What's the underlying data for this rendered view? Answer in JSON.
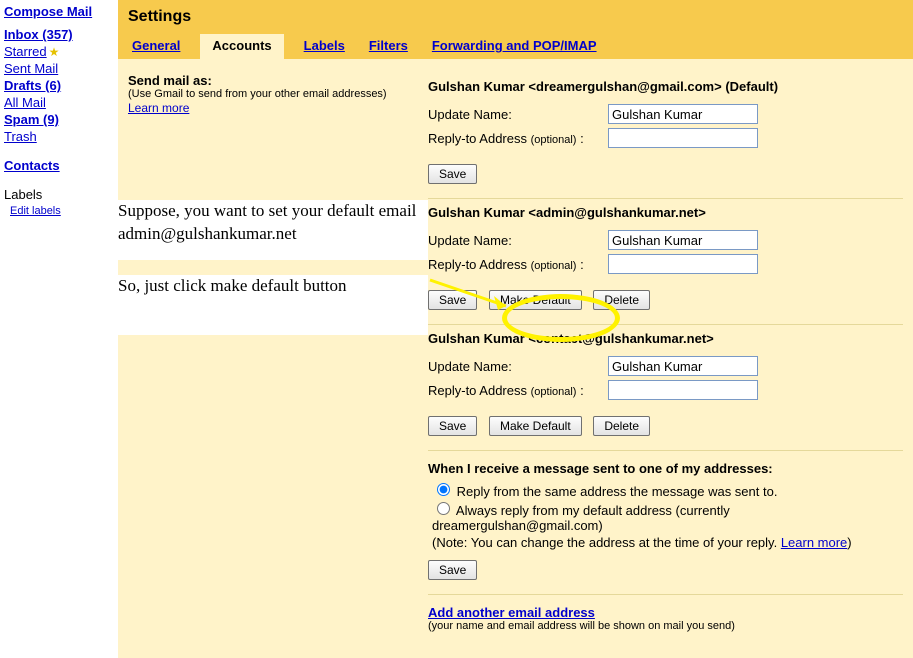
{
  "sidebar": {
    "compose": "Compose Mail",
    "items": [
      {
        "label": "Inbox (357)",
        "bold": true
      },
      {
        "label": "Starred",
        "star": true
      },
      {
        "label": "Sent Mail"
      },
      {
        "label": "Drafts (6)",
        "bold": true
      },
      {
        "label": "All Mail"
      },
      {
        "label": "Spam (9)",
        "bold": true
      },
      {
        "label": "Trash"
      }
    ],
    "contacts": "Contacts",
    "labels_head": "Labels",
    "edit_labels": "Edit labels"
  },
  "settings": {
    "title": "Settings",
    "tabs": [
      "General",
      "Accounts",
      "Labels",
      "Filters",
      "Forwarding and POP/IMAP"
    ],
    "active_tab": 1,
    "send_as": {
      "head": "Send mail as:",
      "sub": "(Use Gmail to send from your other email addresses)",
      "learn_more": "Learn more"
    },
    "labels": {
      "update_name": "Update Name:",
      "reply_to": "Reply-to Address ",
      "optional": "(optional)",
      "colon": ":",
      "save": "Save",
      "make_default": "Make Default",
      "delete": "Delete"
    },
    "addresses": [
      {
        "title": "Gulshan Kumar <dreamergulshan@gmail.com> (Default)",
        "name": "Gulshan Kumar",
        "reply": "",
        "default": true
      },
      {
        "title": "Gulshan Kumar <admin@gulshankumar.net>",
        "name": "Gulshan Kumar",
        "reply": "",
        "default": false
      },
      {
        "title": "Gulshan Kumar <contact@gulshankumar.net>",
        "name": "Gulshan Kumar",
        "reply": "",
        "default": false
      }
    ],
    "reply_behaviour": {
      "head": "When I receive a message sent to one of my addresses:",
      "opt1": "Reply from the same address the message was sent to.",
      "opt2": "Always reply from my default address (currently dreamergulshan@gmail.com)",
      "note_pre": "(Note: You can change the address at the time of your reply. ",
      "learn_more": "Learn more",
      "note_post": ")",
      "selected": 0,
      "save": "Save"
    },
    "add_another": {
      "link": "Add another email address",
      "sub": "(your name and email address will be shown on mail you send)"
    }
  },
  "annotation": {
    "para1": "Suppose, you want to set your default email admin@gulshankumar.net",
    "para2": "So, just click make default button"
  }
}
